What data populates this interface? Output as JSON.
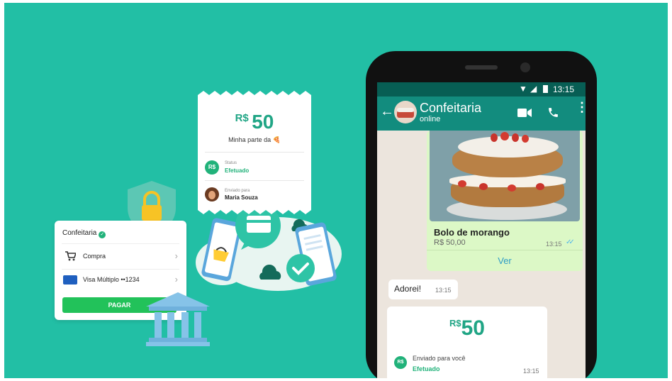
{
  "receipt": {
    "currency": "R$",
    "amount": "50",
    "note": "Minha parte da 🍕",
    "badge": "R$",
    "status_label": "Status",
    "status_value": "Efetuado",
    "sent_label": "Enviado para",
    "sent_value": "Maria Souza"
  },
  "paycard": {
    "title": "Confeitaria",
    "row1": "Compra",
    "row2": "Visa Múltiplo ••1234",
    "pay_button": "PAGAR"
  },
  "phone": {
    "time": "13:15",
    "contact_name": "Confeitaria",
    "contact_status": "online",
    "product_name": "Bolo de morango",
    "product_price": "R$ 50,00",
    "product_time": "13:15",
    "view_button": "Ver",
    "msg_text": "Adorei!",
    "msg_time": "13:15",
    "pay_currency": "R$",
    "pay_amount": "50",
    "pay_badge": "R$",
    "pay_sent": "Enviado para você",
    "pay_status": "Efetuado",
    "pay_time": "13:15"
  },
  "colors": {
    "background": "#22bfa5",
    "whatsapp_dark": "#075e54",
    "whatsapp_header": "#128c7e",
    "success": "#21b27a",
    "bubble_green": "#dcf8c6"
  }
}
